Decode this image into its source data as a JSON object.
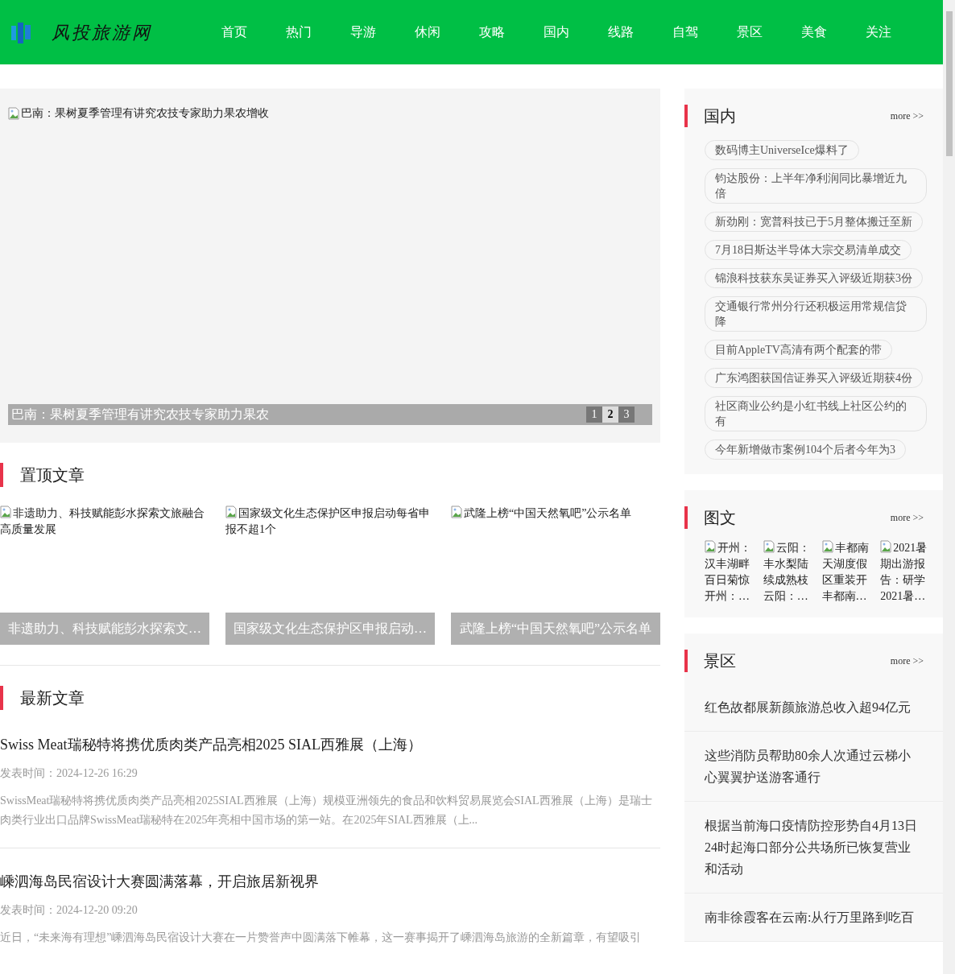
{
  "header": {
    "logo_text": "风投旅游网",
    "nav": [
      {
        "label": "首页"
      },
      {
        "label": "热门"
      },
      {
        "label": "导游"
      },
      {
        "label": "休闲"
      },
      {
        "label": "攻略"
      },
      {
        "label": "国内"
      },
      {
        "label": "线路"
      },
      {
        "label": "自驾"
      },
      {
        "label": "景区"
      },
      {
        "label": "美食"
      },
      {
        "label": "关注"
      }
    ]
  },
  "slider": {
    "image_alt": "巴南：果树夏季管理有讲究农技专家助力果农增收",
    "caption": "巴南：果树夏季管理有讲究农技专家助力果农",
    "pages": [
      {
        "label": "1",
        "selected": false
      },
      {
        "label": "2",
        "selected": true
      },
      {
        "label": "3",
        "selected": false
      }
    ]
  },
  "pinned": {
    "title": "置顶文章",
    "cards": [
      {
        "image_alt": "非遗助力、科技赋能彭水探索文旅融合高质量发展",
        "caption": "非遗助力、科技赋能彭水探索文…"
      },
      {
        "image_alt": "国家级文化生态保护区申报启动每省申报不超1个",
        "caption": "国家级文化生态保护区申报启动…"
      },
      {
        "image_alt": "武隆上榜“中国天然氧吧”公示名单",
        "caption": "武隆上榜“中国天然氧吧”公示名单"
      }
    ]
  },
  "latest": {
    "title": "最新文章",
    "articles": [
      {
        "title": "Swiss Meat瑞秘特将携优质肉类产品亮相2025 SIAL西雅展（上海）",
        "date": "发表时间：2024-12-26 16:29",
        "summary": "SwissMeat瑞秘特将携优质肉类产品亮相2025SIAL西雅展（上海）规模亚洲领先的食品和饮料贸易展览会SIAL西雅展（上海）是瑞士肉类行业出口品牌SwissMeat瑞秘特在2025年亮相中国市场的第一站。在2025年SIAL西雅展（上..."
      },
      {
        "title": "嵊泗海岛民宿设计大赛圆满落幕，开启旅居新视界",
        "date": "发表时间：2024-12-20 09:20",
        "summary": "近日，“未来海有理想”嵊泗海岛民宿设计大赛在一片赞誉声中圆满落下帷幕，这一赛事揭开了嵊泗海岛旅游的全新篇章，有望吸引"
      }
    ]
  },
  "sidebar": {
    "domestic": {
      "title": "国内",
      "more": "more >>",
      "tags": [
        "数码博主UniverseIce爆料了",
        "钧达股份：上半年净利润同比暴增近九倍",
        "新劲刚：宽普科技已于5月整体搬迁至新",
        "7月18日斯达半导体大宗交易清单成交",
        "锦浪科技获东吴证券买入评级近期获3份",
        "交通银行常州分行还积极运用常规信贷降",
        "目前AppleTV高清有两个配套的带",
        "广东鸿图获国信证券买入评级近期获4份",
        "社区商业公约是小红书线上社区公约的有",
        "今年新增做市案例104个后者今年为3"
      ]
    },
    "gallery": {
      "title": "图文",
      "more": "more >>",
      "items": [
        {
          "image_alt": "开州：汉丰湖畔百日菊惊",
          "caption": "开州：…"
        },
        {
          "image_alt": "云阳：丰水梨陆续成熟枝",
          "caption": "云阳：…"
        },
        {
          "image_alt": "丰都南天湖度假区重装开",
          "caption": "丰都南…"
        },
        {
          "image_alt": "2021暑期出游报告：研学",
          "caption": "2021暑…"
        }
      ]
    },
    "scenic": {
      "title": "景区",
      "more": "more >>",
      "items": [
        "红色故都展新颜旅游总收入超94亿元",
        "这些消防员帮助80余人次通过云梯小心翼翼护送游客通行",
        "根据当前海口疫情防控形势自4月13日24时起海口部分公共场所已恢复营业和活动",
        "南非徐霞客在云南:从行万里路到吃百"
      ]
    }
  }
}
